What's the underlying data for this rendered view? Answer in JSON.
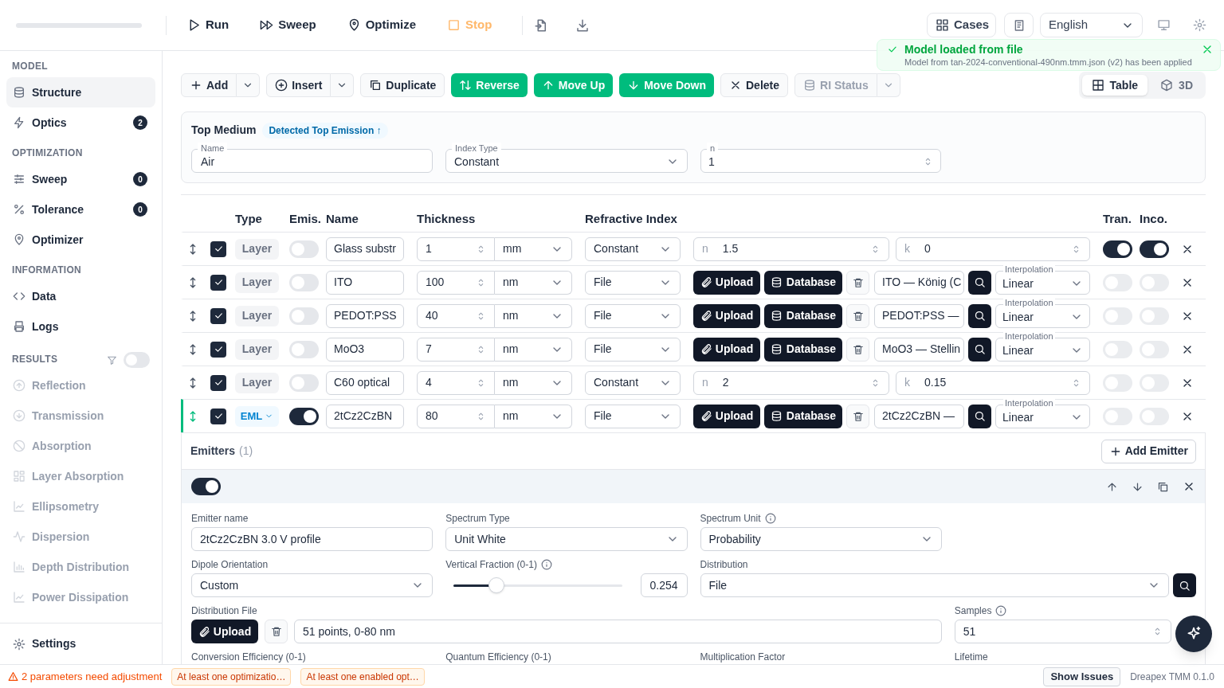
{
  "toolbar": {
    "progress": {
      "level": 0
    },
    "actions": [
      {
        "label": "Run",
        "kind": "run"
      },
      {
        "label": "Sweep",
        "kind": "sweep"
      },
      {
        "label": "Optimize",
        "kind": "optimize"
      },
      {
        "label": "Stop",
        "kind": "stop"
      }
    ],
    "cases": "Cases",
    "language": "English"
  },
  "toast": {
    "title": "Model loaded from file",
    "message": "Model from tan-2024-conventional-490nm.tmm.json (v2) has been applied"
  },
  "sidebar": {
    "sections": [
      {
        "title": "MODEL",
        "items": [
          {
            "label": "Structure",
            "selected": true
          },
          {
            "label": "Optics",
            "badge": "2",
            "selected": false
          }
        ]
      },
      {
        "title": "OPTIMIZATION",
        "items": [
          {
            "label": "Sweep",
            "badge": "0",
            "selected": false
          },
          {
            "label": "Tolerance",
            "badge": "0",
            "selected": false
          },
          {
            "label": "Optimizer",
            "selected": false
          }
        ]
      },
      {
        "title": "INFORMATION",
        "items": [
          {
            "label": "Data",
            "selected": false
          },
          {
            "label": "Logs",
            "selected": false
          }
        ]
      },
      {
        "title": "RESULTS",
        "filter_on": false,
        "items": [
          {
            "label": "Reflection",
            "disabled": true
          },
          {
            "label": "Transmission",
            "disabled": true
          },
          {
            "label": "Absorption",
            "disabled": true
          },
          {
            "label": "Layer Absorption",
            "disabled": true
          },
          {
            "label": "Ellipsometry",
            "disabled": true
          },
          {
            "label": "Dispersion",
            "disabled": true
          },
          {
            "label": "Depth Distribution",
            "disabled": true
          },
          {
            "label": "Power Dissipation",
            "disabled": true
          }
        ]
      }
    ],
    "settings": "Settings"
  },
  "structure_toolbar": {
    "buttons": [
      {
        "label": "Add",
        "kind": "split"
      },
      {
        "label": "Insert",
        "kind": "split"
      },
      {
        "label": "Duplicate",
        "kind": "plain"
      },
      {
        "label": "Reverse",
        "kind": "primary"
      },
      {
        "label": "Move Up",
        "kind": "primary"
      },
      {
        "label": "Move Down",
        "kind": "primary"
      },
      {
        "label": "Delete",
        "kind": "plain"
      },
      {
        "label": "RI Status",
        "kind": "split_muted"
      }
    ],
    "views": [
      {
        "label": "Table",
        "selected": true
      },
      {
        "label": "3D",
        "selected": false
      }
    ]
  },
  "top_medium": {
    "title": "Top Medium",
    "badge": "Detected Top Emission ↑",
    "name_label": "Name",
    "name": "Air",
    "index_type_label": "Index Type",
    "index_type": "Constant",
    "n_label": "n",
    "n": "1"
  },
  "layers": {
    "columns": [
      "Type",
      "Emis.",
      "Name",
      "Thickness",
      "Refractive Index",
      "Tran.",
      "Inco."
    ],
    "rows": [
      {
        "selected": false,
        "checked": true,
        "type": "Layer",
        "kind": "layer",
        "emissive": false,
        "name": "Glass substr",
        "thickness": "1",
        "unit": "mm",
        "index": {
          "kind": "constant",
          "type": "Constant",
          "n_label": "n",
          "n": "1.5",
          "k_label": "k",
          "k": "0"
        },
        "transparent": true,
        "incoherent": true
      },
      {
        "selected": false,
        "checked": true,
        "type": "Layer",
        "kind": "layer",
        "emissive": false,
        "name": "ITO",
        "thickness": "100",
        "unit": "nm",
        "index": {
          "kind": "file",
          "type": "File",
          "upload": "Upload",
          "database": "Database",
          "file": "ITO — König (C",
          "interpolation_label": "Interpolation",
          "interpolation": "Linear"
        },
        "transparent": false,
        "incoherent": false
      },
      {
        "selected": false,
        "checked": true,
        "type": "Layer",
        "kind": "layer",
        "emissive": false,
        "name": "PEDOT:PSS",
        "thickness": "40",
        "unit": "nm",
        "index": {
          "kind": "file",
          "type": "File",
          "upload": "Upload",
          "database": "Database",
          "file": "PEDOT:PSS —",
          "interpolation_label": "Interpolation",
          "interpolation": "Linear"
        },
        "transparent": false,
        "incoherent": false
      },
      {
        "selected": false,
        "checked": true,
        "type": "Layer",
        "kind": "layer",
        "emissive": false,
        "name": "MoO3",
        "thickness": "7",
        "unit": "nm",
        "index": {
          "kind": "file",
          "type": "File",
          "upload": "Upload",
          "database": "Database",
          "file": "MoO3 — Stellin",
          "interpolation_label": "Interpolation",
          "interpolation": "Linear"
        },
        "transparent": false,
        "incoherent": false
      },
      {
        "selected": false,
        "checked": true,
        "type": "Layer",
        "kind": "layer",
        "emissive": false,
        "name": "C60 optical",
        "thickness": "4",
        "unit": "nm",
        "index": {
          "kind": "constant",
          "type": "Constant",
          "n_label": "n",
          "n": "2",
          "k_label": "k",
          "k": "0.15"
        },
        "transparent": false,
        "incoherent": false
      },
      {
        "selected": true,
        "checked": true,
        "type": "EML",
        "kind": "emitter",
        "emissive": true,
        "name": "2tCz2CzBN",
        "thickness": "80",
        "unit": "nm",
        "index": {
          "kind": "file",
          "type": "File",
          "upload": "Upload",
          "database": "Database",
          "file": "2tCz2CzBN —",
          "interpolation_label": "Interpolation",
          "interpolation": "Linear"
        },
        "transparent": false,
        "incoherent": false
      }
    ]
  },
  "emitters": {
    "title": "Emitters",
    "count": "(1)",
    "add": "Add Emitter",
    "items": [
      {
        "enabled": true,
        "name_label": "Emitter name",
        "name": "2tCz2CzBN 3.0 V profile",
        "spectrum_type_label": "Spectrum Type",
        "spectrum_type": "Unit White",
        "spectrum_unit_label": "Spectrum Unit",
        "spectrum_unit": "Probability",
        "dipole_label": "Dipole Orientation",
        "dipole": "Custom",
        "vertical_fraction_label": "Vertical Fraction (0-1)",
        "vertical_fraction": {
          "level": 0.254,
          "value": "0.254"
        },
        "distribution_label": "Distribution",
        "distribution": "File",
        "distribution_file_label": "Distribution File",
        "file_upload": "Upload",
        "distribution_file": "51 points, 0-80 nm",
        "samples_label": "Samples",
        "samples": "51",
        "more_labels": [
          "Conversion Efficiency (0-1)",
          "Quantum Efficiency (0-1)",
          "Multiplication Factor",
          "Lifetime"
        ]
      }
    ]
  },
  "status_bar": {
    "warning": "2 parameters need adjustment",
    "tags": [
      "At least one optimizatio…",
      "At least one enabled opt…"
    ],
    "show_issues": "Show Issues",
    "version": "Dreapex TMM 0.1.0"
  }
}
